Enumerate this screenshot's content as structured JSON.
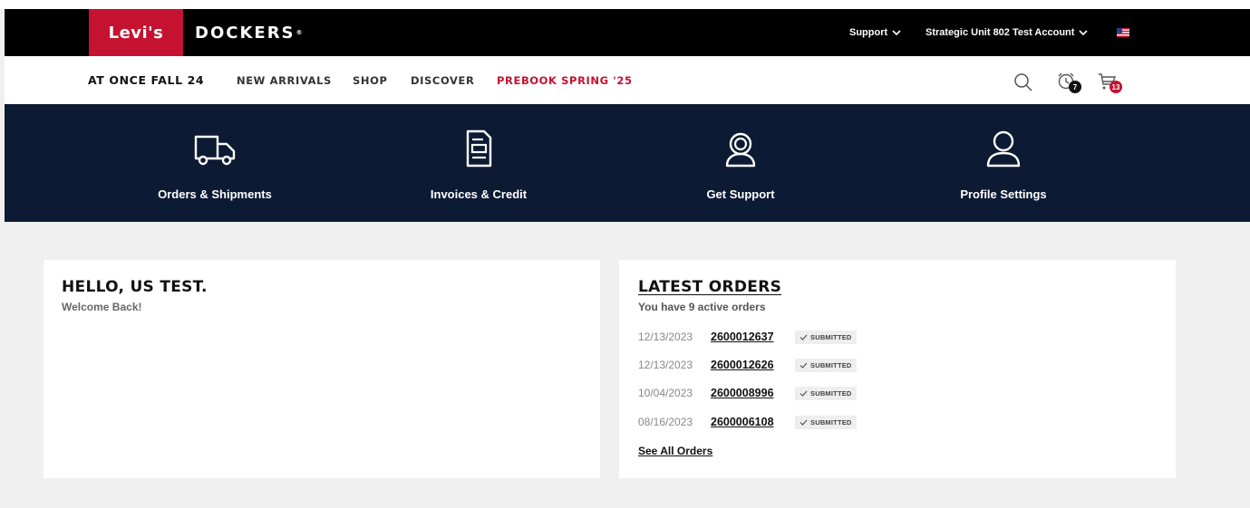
{
  "header": {
    "brand_levis": "Levi's",
    "brand_dockers": "DOCKERS",
    "brand_dockers_mark": "®",
    "support_label": "Support",
    "account_label": "Strategic Unit 802 Test Account",
    "flag_icon": "us-flag-icon"
  },
  "nav": {
    "items": [
      "AT ONCE FALL 24",
      "NEW ARRIVALS",
      "SHOP",
      "DISCOVER",
      "PREBOOK SPRING '25"
    ],
    "accent_color": "#c41230",
    "icons": [
      "search-icon",
      "alarm-clock-icon",
      "cart-icon"
    ],
    "alarm_badge": "7",
    "cart_badge": "13"
  },
  "hero": {
    "items": [
      {
        "label": "Orders & Shipments",
        "icon": "truck-icon"
      },
      {
        "label": "Invoices & Credit",
        "icon": "document-icon"
      },
      {
        "label": "Get Support",
        "icon": "headset-icon"
      },
      {
        "label": "Profile Settings",
        "icon": "user-icon"
      }
    ],
    "background": "#0d1a33"
  },
  "welcome": {
    "title": "HELLO, US TEST.",
    "subtitle": "Welcome Back!"
  },
  "orders": {
    "title": "LATEST ORDERS",
    "subtitle": "You have 9 active orders",
    "rows": [
      {
        "date": "12/13/2023",
        "number": "2600012637",
        "status": "SUBMITTED"
      },
      {
        "date": "12/13/2023",
        "number": "2600012626",
        "status": "SUBMITTED"
      },
      {
        "date": "10/04/2023",
        "number": "2600008996",
        "status": "SUBMITTED"
      },
      {
        "date": "08/16/2023",
        "number": "2600006108",
        "status": "SUBMITTED"
      }
    ],
    "see_all": "See All Orders"
  }
}
